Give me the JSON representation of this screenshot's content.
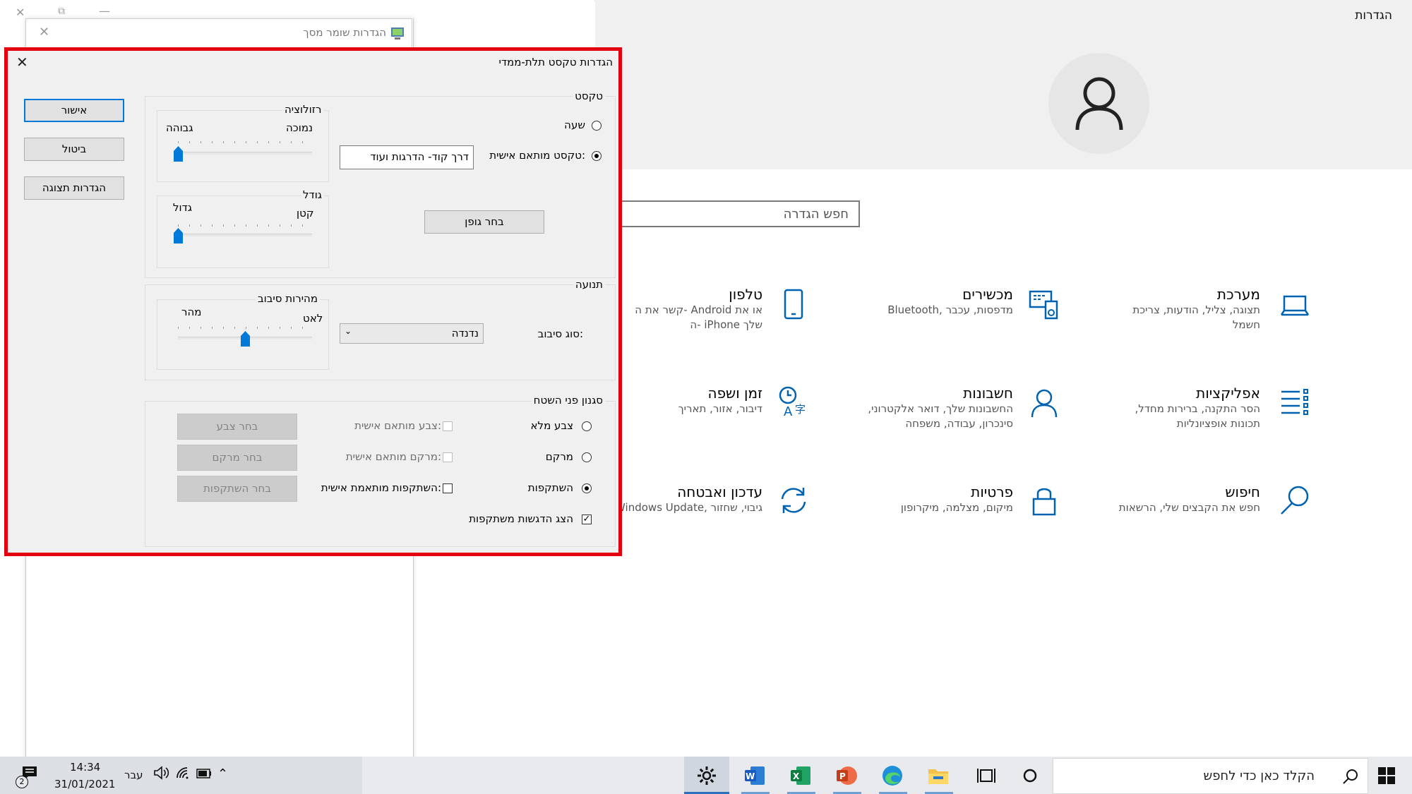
{
  "settings": {
    "title": "הגדרות",
    "search_placeholder": "חפש הגדרה",
    "tiles": [
      {
        "title": "מערכת",
        "desc": "תצוגה, צליל, הודעות, צריכת חשמל",
        "icon": "laptop-icon"
      },
      {
        "title": "מכשירים",
        "desc": "Bluetooth, מדפסות, עכבר",
        "icon": "keyboard-icon"
      },
      {
        "title": "טלפון",
        "desc": "קשר את ה- Android או את ה- iPhone שלך",
        "icon": "phone-icon"
      },
      {
        "title": "אפליקציות",
        "desc": "הסר התקנה, ברירות מחדל, תכונות אופציונליות",
        "icon": "apps-list-icon"
      },
      {
        "title": "חשבונות",
        "desc": "החשבונות שלך, דואר אלקטרוני, סינכרון, עבודה, משפחה",
        "icon": "person-icon"
      },
      {
        "title": "זמן ושפה",
        "desc": "דיבור, אזור, תאריך",
        "icon": "time-language-icon"
      },
      {
        "title": "חיפוש",
        "desc": "חפש את הקבצים שלי, הרשאות",
        "icon": "search-icon"
      },
      {
        "title": "פרטיות",
        "desc": "מיקום, מצלמה, מיקרופון",
        "icon": "lock-icon"
      },
      {
        "title": "עדכון ואבטחה",
        "desc": "Windows Update, גיבוי, שחזור",
        "icon": "sync-icon"
      }
    ]
  },
  "bg_window": {
    "title": "הגדרות שומר מסך"
  },
  "dialog": {
    "title": "הגדרות טקסט תלת-ממדי",
    "buttons": {
      "ok": "אישור",
      "cancel": "ביטול",
      "display": "הגדרות תצוגה"
    },
    "text_group": {
      "label": "טקסט",
      "time_option": "שעה",
      "custom_option": "טקסט מותאם אישית:",
      "custom_value": "דרך קוד- הדרגות ועוד",
      "choose_font": "בחר גופן",
      "resolution": {
        "label": "רזולוציה",
        "low": "נמוכה",
        "high": "גבוהה",
        "value": 0
      },
      "size": {
        "label": "גודל",
        "small": "קטן",
        "large": "גדול",
        "value": 0
      }
    },
    "motion_group": {
      "label": "תנועה",
      "spin_type_label": "סוג סיבוב:",
      "spin_type_value": "נדנדה",
      "spin_speed": {
        "label": "מהירות סיבוב",
        "slow": "לאט",
        "fast": "מהר",
        "value": 0.5
      }
    },
    "surface_group": {
      "label": "סגנון פני השטח",
      "solid": "צבע מלא",
      "texture": "מרקם",
      "reflection": "השתקפות",
      "custom_color": "צבע מותאם אישית:",
      "custom_texture": "מרקם מותאם אישית:",
      "custom_reflection": "השתקפות מותאמת אישית:",
      "choose_color": "בחר צבע",
      "choose_texture": "בחר מרקם",
      "choose_reflection": "בחר השתקפות",
      "show_highlights": "הצג הדגשות משתקפות",
      "selected": "reflection",
      "show_highlights_checked": true
    }
  },
  "taskbar": {
    "search_placeholder": "הקלד כאן כדי לחפש",
    "time": "14:34",
    "date": "31/01/2021",
    "language": "עבר",
    "notification_count": "2"
  }
}
